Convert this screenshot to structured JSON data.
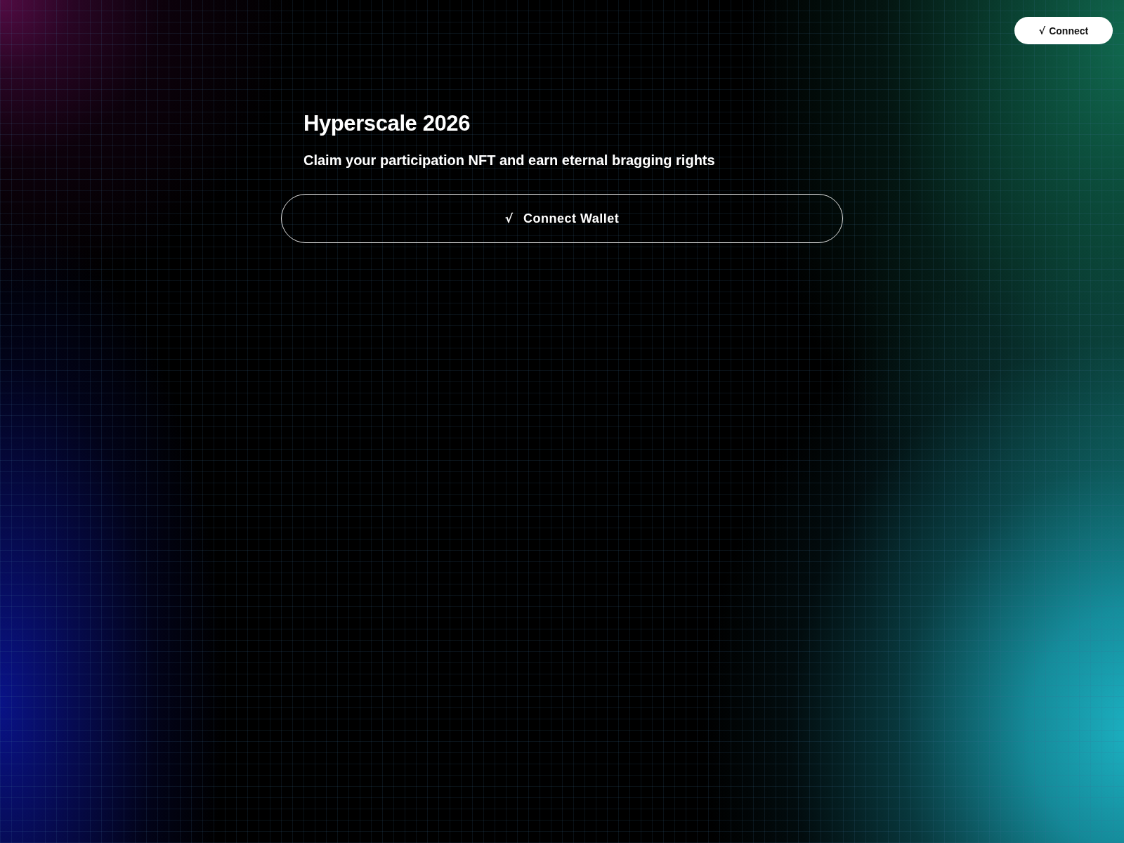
{
  "header": {
    "connect_button": {
      "icon": "√",
      "label": "Connect"
    }
  },
  "hero": {
    "title": "Hyperscale 2026",
    "subtitle": "Claim your participation NFT and earn eternal bragging rights",
    "connect_wallet_button": {
      "icon": "√",
      "label": "Connect Wallet"
    }
  }
}
